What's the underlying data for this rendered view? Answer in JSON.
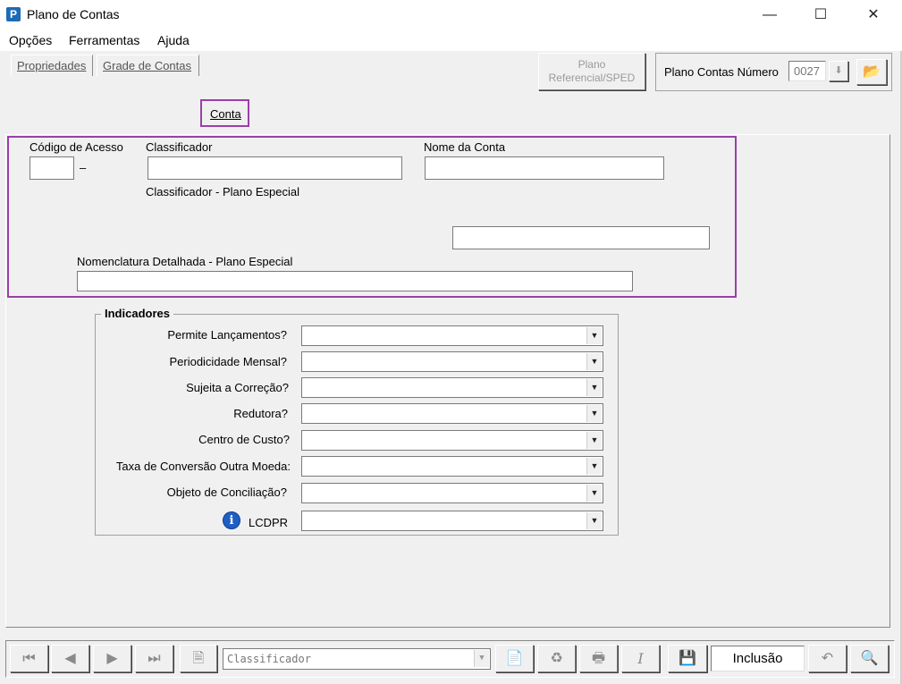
{
  "window": {
    "title": "Plano de Contas"
  },
  "menu": [
    "Opções",
    "Ferramentas",
    "Ajuda"
  ],
  "toolbar_top": {
    "sped_button": "Plano\nReferencial/SPED",
    "plano_label": "Plano Contas Número",
    "plano_value": "0027"
  },
  "tabs": [
    "Propriedades",
    "Grade de Contas",
    "Conta"
  ],
  "form": {
    "codigo_label": "Código de Acesso",
    "dash": "–",
    "classificador_label": "Classificador",
    "nome_label": "Nome da Conta",
    "class_especial_label": "Classificador  - Plano Especial",
    "nomenclatura_label": "Nomenclatura Detalhada - Plano Especial"
  },
  "indicadores": {
    "title": "Indicadores",
    "rows": [
      "Permite Lançamentos?",
      "Periodicidade Mensal?",
      "Sujeita a Correção?",
      "Redutora?",
      "Centro de Custo?",
      "Taxa de Conversão Outra Moeda:",
      "Objeto de Conciliação?",
      "LCDPR"
    ]
  },
  "bottom": {
    "order_value": "Classificador",
    "mode": "Inclusão"
  },
  "colors": {
    "highlight": "#9b3fa8",
    "info_icon": "#1f5fc4"
  }
}
